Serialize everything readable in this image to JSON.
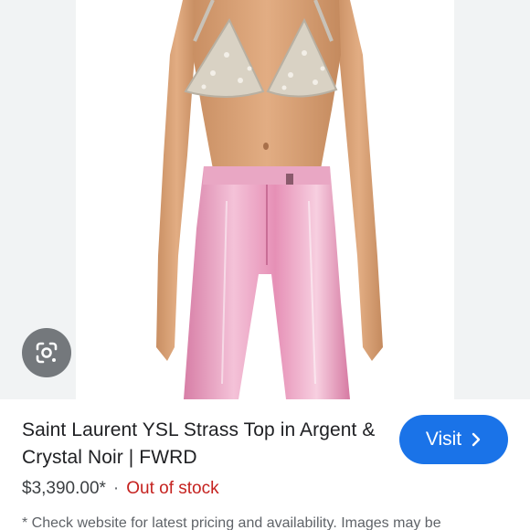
{
  "product": {
    "title": "Saint Laurent YSL Strass Top in Argent & Crystal Noir | FWRD",
    "price": "$3,390.00*",
    "separator": "·",
    "stock_status": "Out of stock",
    "disclaimer": "* Check website for latest pricing and availability. Images may be"
  },
  "actions": {
    "visit_label": "Visit",
    "visit_icon": "chevron-right-icon",
    "lens_icon": "google-lens-icon"
  },
  "colors": {
    "visit_button": "#1a73e8",
    "out_of_stock": "#c5221f",
    "title_text": "#202124"
  }
}
